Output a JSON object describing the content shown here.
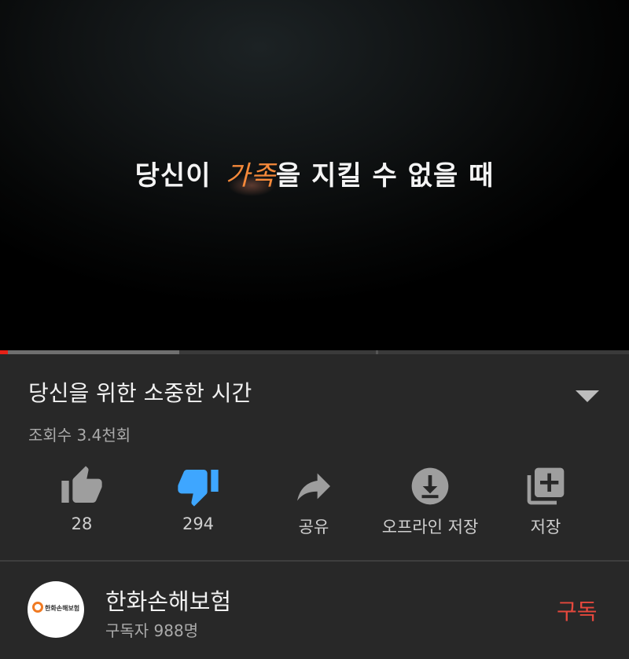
{
  "player": {
    "caption_part1": "당신이",
    "caption_highlight": "가족",
    "caption_part2": "을 지킬 수 없을 때",
    "progress_played": 0.012,
    "progress_buffered": 0.285,
    "accent_color": "#e62117",
    "caption_highlight_color": "#f5893a"
  },
  "video": {
    "title": "당신을 위한 소중한 시간",
    "views": "조회수 3.4천회",
    "expand_icon": "chevron-down-icon"
  },
  "actions": [
    {
      "icon": "thumbs-up-icon",
      "label": "28",
      "color": "#9e9e9e"
    },
    {
      "icon": "thumbs-down-icon",
      "label": "294",
      "color": "#3ea6ff"
    },
    {
      "icon": "share-icon",
      "label": "공유",
      "color": "#9e9e9e"
    },
    {
      "icon": "download-icon",
      "label": "오프라인 저장",
      "color": "#9e9e9e"
    },
    {
      "icon": "add-to-playlist-icon",
      "label": "저장",
      "color": "#9e9e9e"
    }
  ],
  "channel": {
    "name": "한화손해보험",
    "subscribers": "구독자 988명",
    "avatar_text": "한화손해보험",
    "subscribe_label": "구독",
    "subscribe_color": "#e6483d"
  }
}
